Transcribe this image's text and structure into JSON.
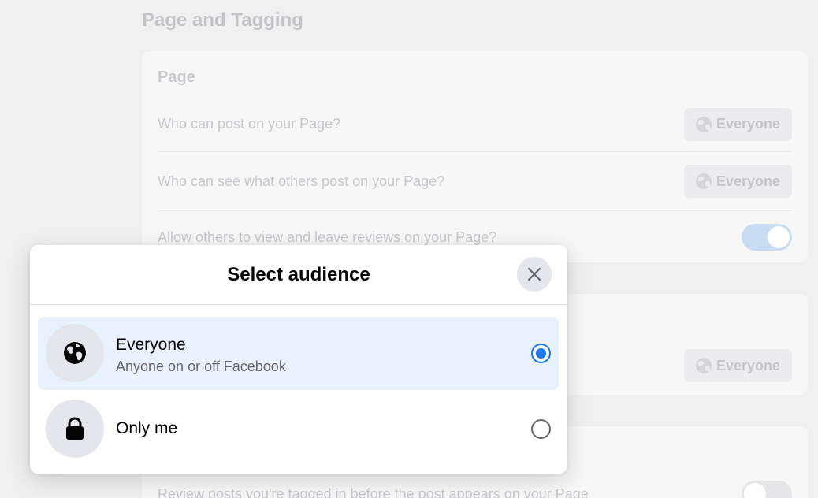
{
  "background": {
    "section_title": "Page and Tagging",
    "page_card": {
      "title": "Page",
      "rows": [
        {
          "label": "Who can post on your Page?",
          "audience": "Everyone"
        },
        {
          "label": "Who can see what others post on your Page?",
          "audience": "Everyone"
        },
        {
          "label": "Allow others to view and leave reviews on your Page?",
          "toggle": "on"
        }
      ]
    },
    "card2": {
      "audience": "Everyone"
    },
    "card3": {
      "row_label": "Review posts you're tagged in before the post appears on your Page",
      "toggle": "off"
    }
  },
  "modal": {
    "title": "Select audience",
    "close_icon": "close-icon",
    "options": [
      {
        "name": "Everyone",
        "description": "Anyone on or off Facebook",
        "icon": "globe-icon",
        "selected": true
      },
      {
        "name": "Only me",
        "icon": "lock-icon",
        "selected": false
      }
    ]
  },
  "colors": {
    "accent": "#1877f2",
    "selected_bg": "#e7f2fe",
    "icon_bg": "#e4e6eb"
  }
}
